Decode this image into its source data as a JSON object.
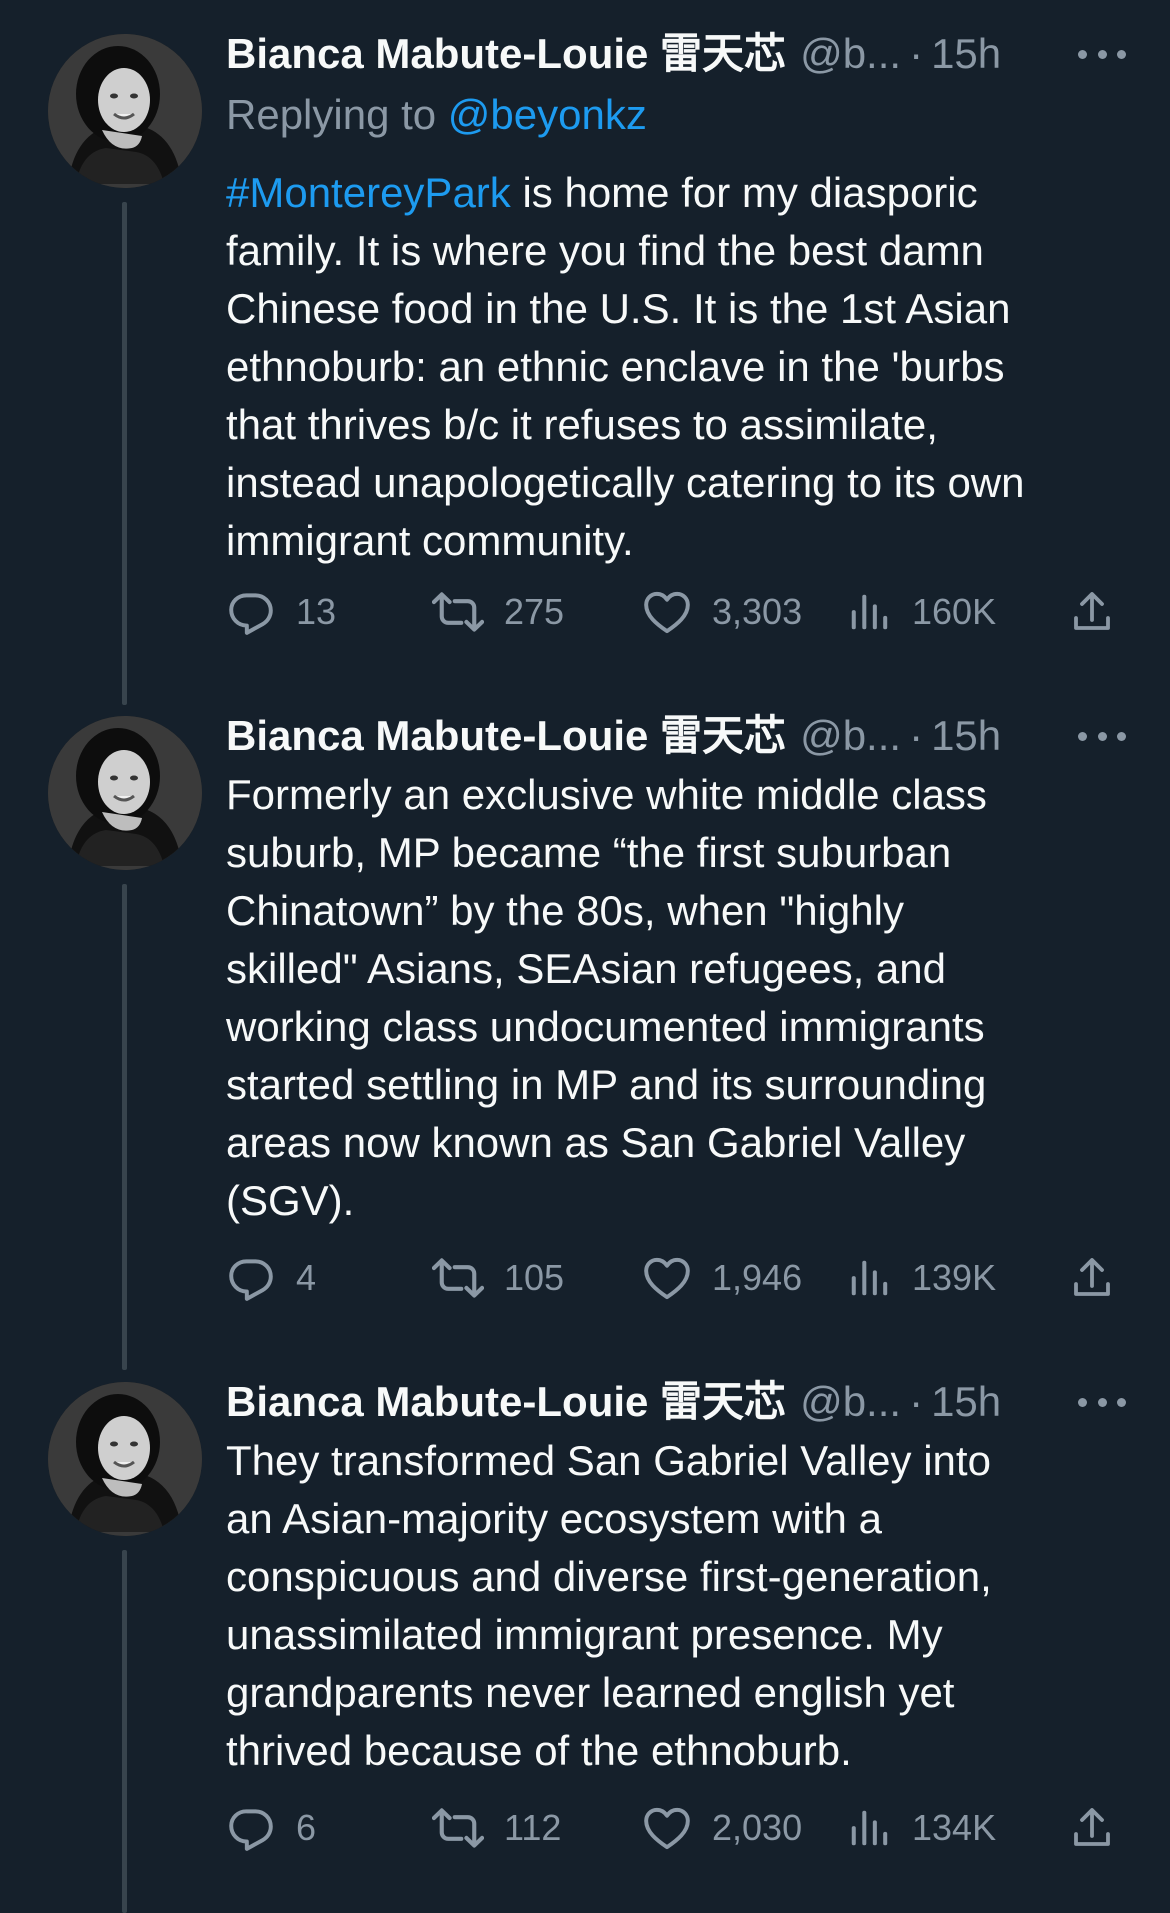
{
  "tweets": [
    {
      "author": "Bianca Mabute-Louie 雷天芯",
      "handle": "@b...",
      "dot": "·",
      "time": "15h",
      "replying_prefix": "Replying to ",
      "replying_to": "@beyonkz",
      "hashtag": "#MontereyPark",
      "text": " is home for my diasporic\nfamily. It is where you find the best damn\nChinese food in the U.S. It is the 1st Asian\nethnoburb: an ethnic enclave in the 'burbs\nthat thrives b/c it refuses to assimilate,\ninstead unapologetically catering to its own\nimmigrant community.",
      "replies": "13",
      "retweets": "275",
      "likes": "3,303",
      "views": "160K"
    },
    {
      "author": "Bianca Mabute-Louie 雷天芯",
      "handle": "@b...",
      "dot": "·",
      "time": "15h",
      "text": "Formerly an exclusive white middle class\nsuburb, MP became “the first suburban\nChinatown” by the 80s, when \"highly\nskilled\" Asians, SEAsian refugees, and\nworking class undocumented immigrants\nstarted settling in MP and its surrounding\nareas now known as San Gabriel Valley\n(SGV).",
      "replies": "4",
      "retweets": "105",
      "likes": "1,946",
      "views": "139K"
    },
    {
      "author": "Bianca Mabute-Louie 雷天芯",
      "handle": "@b...",
      "dot": "·",
      "time": "15h",
      "text": "They transformed San Gabriel Valley into\nan Asian-majority ecosystem with a\nconspicuous and diverse first-generation,\nunassimilated immigrant presence. My\ngrandparents never learned english yet\nthrived because of the ethnoburb.",
      "replies": "6",
      "retweets": "112",
      "likes": "2,030",
      "views": "134K"
    }
  ],
  "colors": {
    "background": "#15202b",
    "text": "#f7f9f9",
    "muted": "#8b98a5",
    "link": "#1d9bf0",
    "thread_line": "#38444d"
  },
  "icons": [
    "reply-icon",
    "retweet-icon",
    "like-icon",
    "views-icon",
    "share-icon",
    "more-icon"
  ]
}
